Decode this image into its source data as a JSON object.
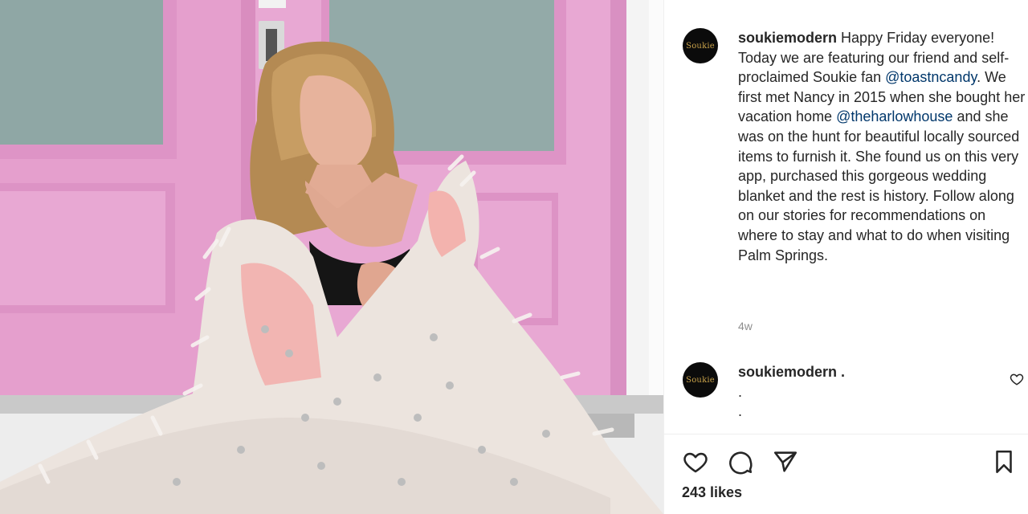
{
  "post": {
    "username": "soukiemodern",
    "avatar_text": "Soukie",
    "caption_parts": [
      "Happy Friday everyone! Today we are featuring our friend and self-proclaimed Soukie fan ",
      "@toastncandy",
      ". We first met Nancy in 2015 when she bought her vacation home ",
      "@theharlowhouse",
      " and she was on the hunt for beautiful locally sourced items to furnish it. She found us on this very app, purchased this gorgeous wedding blanket and the rest is history. Follow along on our stories for recommendations on where to stay and what to do when visiting Palm Springs."
    ],
    "age": "4w"
  },
  "comment": {
    "username": "soukiemodern .",
    "avatar_text": "Soukie",
    "text": ".\n."
  },
  "actions": {
    "like_icon": "heart-icon",
    "comment_icon": "comment-icon",
    "share_icon": "share-icon",
    "save_icon": "bookmark-icon"
  },
  "likes": "243 likes",
  "colors": {
    "door_pink": "#e9a6d2",
    "link_blue": "#00376b",
    "meta_gray": "#8e8e8e"
  }
}
